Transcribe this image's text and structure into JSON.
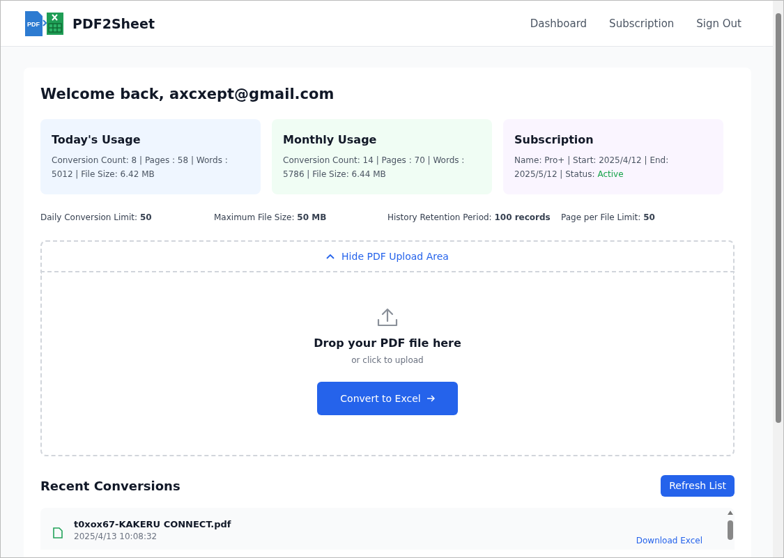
{
  "header": {
    "logo_text": "PDF",
    "brand": "PDF2Sheet",
    "nav": [
      {
        "label": "Dashboard"
      },
      {
        "label": "Subscription"
      },
      {
        "label": "Sign Out"
      }
    ]
  },
  "welcome": "Welcome back, axcxept@gmail.com",
  "cards": [
    {
      "title": "Today's Usage",
      "text": "Conversion Count: 8 | Pages : 58 | Words : 5012 | File Size: 6.42 MB",
      "color": "#eff6ff"
    },
    {
      "title": "Monthly Usage",
      "text": "Conversion Count: 14 | Pages : 70 | Words : 5786 | File Size: 6.44 MB",
      "color": "#f0fdf4"
    },
    {
      "title": "Subscription",
      "text": "Name: Pro+ | Start: 2025/4/12 | End: 2025/5/12 | Status:",
      "status": "Active",
      "color": "#faf5ff"
    }
  ],
  "limits": [
    {
      "label": "Daily Conversion Limit:",
      "value": "50"
    },
    {
      "label": "Maximum File Size:",
      "value": "50 MB"
    },
    {
      "label": "History Retention Period:",
      "value": "100 records"
    },
    {
      "label": "Page per File Limit:",
      "value": "50"
    }
  ],
  "upload": {
    "toggle": "Hide PDF Upload Area",
    "expanded": true,
    "title": "Drop your PDF file here",
    "subtitle": "or click to upload",
    "button": "Convert to Excel"
  },
  "recent": {
    "title": "Recent Conversions",
    "refresh": "Refresh List",
    "items": [
      {
        "name": "t0xox67-KAKERU CONNECT.pdf",
        "date": "2025/4/13 10:08:32",
        "action": "Download Excel"
      }
    ]
  }
}
